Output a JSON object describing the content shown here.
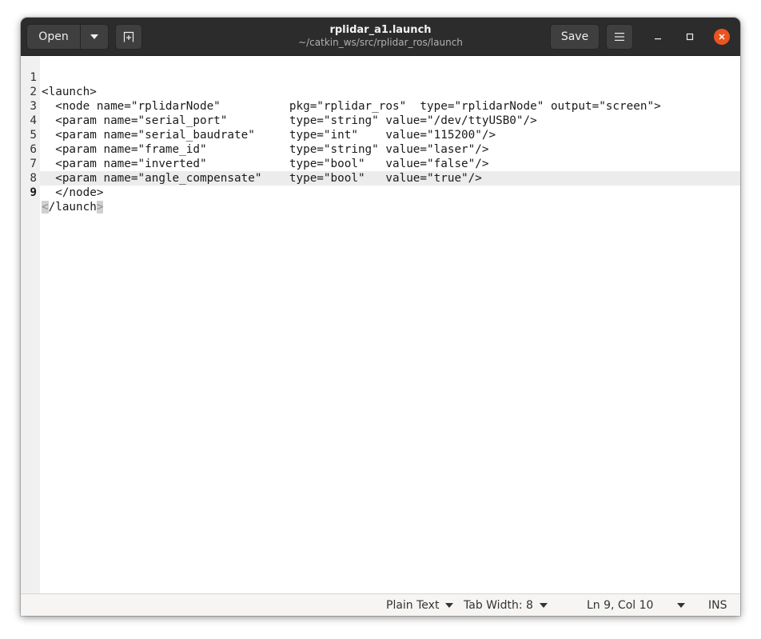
{
  "header": {
    "open_label": "Open",
    "save_label": "Save",
    "title": "rplidar_a1.launch",
    "subtitle": "~/catkin_ws/src/rplidar_ros/launch"
  },
  "editor": {
    "lines": [
      {
        "number": "1",
        "text": "<launch>"
      },
      {
        "number": "2",
        "text": "  <node name=\"rplidarNode\"          pkg=\"rplidar_ros\"  type=\"rplidarNode\" output=\"screen\">"
      },
      {
        "number": "3",
        "text": "  <param name=\"serial_port\"         type=\"string\" value=\"/dev/ttyUSB0\"/>"
      },
      {
        "number": "4",
        "text": "  <param name=\"serial_baudrate\"     type=\"int\"    value=\"115200\"/>"
      },
      {
        "number": "5",
        "text": "  <param name=\"frame_id\"            type=\"string\" value=\"laser\"/>"
      },
      {
        "number": "6",
        "text": "  <param name=\"inverted\"            type=\"bool\"   value=\"false\"/>"
      },
      {
        "number": "7",
        "text": "  <param name=\"angle_compensate\"    type=\"bool\"   value=\"true\"/>"
      },
      {
        "number": "8",
        "text": "  </node>"
      },
      {
        "number": "9",
        "open": "<",
        "text": "/launch",
        "close": ">"
      }
    ]
  },
  "statusbar": {
    "language": "Plain Text",
    "tab_width": "Tab Width: 8",
    "cursor_position": "Ln 9, Col 10",
    "insert_mode": "INS"
  },
  "colors": {
    "headerbar": "#2c2c2c",
    "close_button": "#e95420",
    "gutter": "#f0f0f0",
    "current_line": "#ececec"
  }
}
